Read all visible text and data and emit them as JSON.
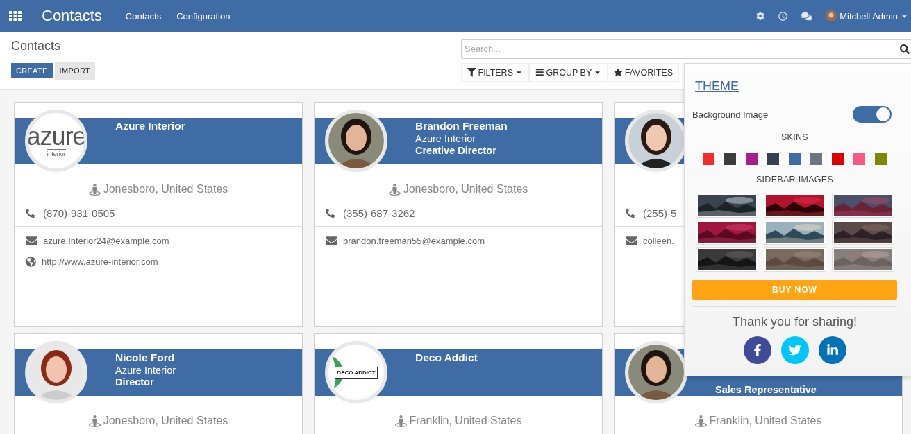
{
  "topbar": {
    "app_title": "Contacts",
    "menus": [
      "Contacts",
      "Configuration"
    ],
    "user": "Mitchell Admin"
  },
  "control_panel": {
    "breadcrumb": "Contacts",
    "buttons": [
      {
        "label": "CREATE",
        "kind": "primary"
      },
      {
        "label": "IMPORT",
        "kind": "secondary"
      }
    ],
    "search": {
      "placeholder": "Search..."
    },
    "filters": [
      {
        "label": "FILTERS",
        "kind": "filter"
      },
      {
        "label": "GROUP BY",
        "kind": "group"
      },
      {
        "label": "FAVORITES",
        "kind": "favorite"
      }
    ]
  },
  "cards": [
    {
      "avatar": {
        "kind": "logo",
        "lines": [
          "azure",
          "interior"
        ]
      },
      "name": "Azure Interior",
      "location": "Jonesboro, United States",
      "phone": "(870)-931-0505",
      "email": "azure.Interior24@example.com",
      "website": "http://www.azure-interior.com"
    },
    {
      "name": "Brandon Freeman",
      "company": "Azure Interior",
      "job_title": "Creative Director",
      "location": "Jonesboro, United States",
      "phone": "(355)-687-3262",
      "email": "brandon.freeman55@example.com"
    },
    {
      "phone": "(255)-5",
      "email": "colleen."
    },
    {
      "name": "Nicole Ford",
      "company": "Azure Interior",
      "job_title": "Director",
      "location": "Jonesboro, United States"
    },
    {
      "avatar": {
        "kind": "logo",
        "lines": [
          "DECO ADDICT"
        ]
      },
      "name": "Deco Addict",
      "location": "Franklin, United States"
    },
    {
      "job_title": "Sales Representative",
      "location": "Franklin, United States"
    }
  ],
  "theme_panel": {
    "title": "THEME",
    "background_image": {
      "label": "Background Image",
      "on": true
    },
    "skins_label": "SKINS",
    "skins": [
      {
        "color": "#f92a2a"
      },
      {
        "color": "#3d3d3d"
      },
      {
        "color": "#a51f8a"
      },
      {
        "color": "#363f54"
      },
      {
        "color": "#3f6ca5"
      },
      {
        "color": "#6d7585"
      },
      {
        "color": "#dd0000"
      },
      {
        "color": "#fa5883"
      },
      {
        "color": "#7d8a00"
      }
    ],
    "sidebar_images_label": "SIDEBAR IMAGES",
    "buy_button": "BUY NOW",
    "share_text": "Thank you for sharing!",
    "social": [
      {
        "kind": "facebook",
        "color": "#3f4a98"
      },
      {
        "kind": "twitter",
        "color": "#00c6ff"
      },
      {
        "kind": "linkedin",
        "color": "#0072b5"
      }
    ]
  }
}
